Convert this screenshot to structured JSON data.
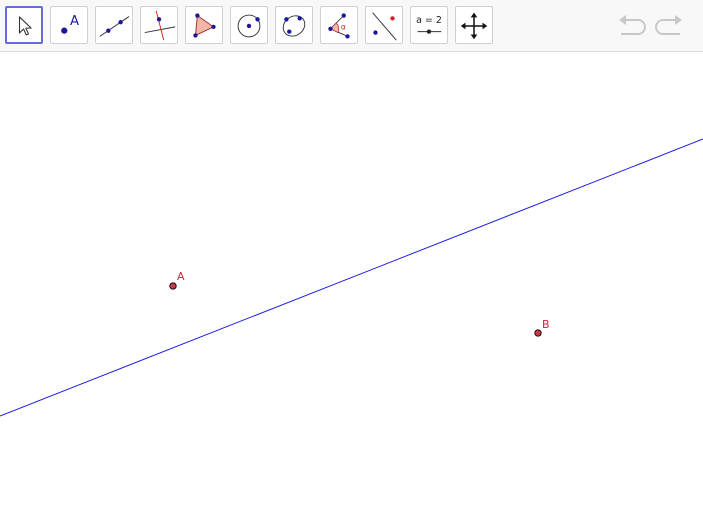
{
  "toolbar": {
    "tools": [
      {
        "name": "move-tool",
        "selected": true
      },
      {
        "name": "point-tool",
        "label": "A"
      },
      {
        "name": "line-tool"
      },
      {
        "name": "perpendicular-line-tool"
      },
      {
        "name": "polygon-tool"
      },
      {
        "name": "circle-with-center-tool"
      },
      {
        "name": "conic-through-5-points-tool"
      },
      {
        "name": "angle-tool",
        "label": "α"
      },
      {
        "name": "reflect-about-line-tool"
      },
      {
        "name": "slider-tool",
        "label": "a = 2"
      },
      {
        "name": "move-graphics-view-tool"
      }
    ],
    "undo_icon": "undo-icon",
    "redo_icon": "redo-icon"
  },
  "graphics": {
    "points": [
      {
        "label": "A",
        "color": "#d6203c"
      },
      {
        "label": "B",
        "color": "#d6203c"
      }
    ],
    "line_color": "#2020e0",
    "point_fill": "#cc3a4a",
    "selection_color": "#6a6ad8",
    "icon_blue": "#1a1a99",
    "icon_red": "#d02020"
  }
}
